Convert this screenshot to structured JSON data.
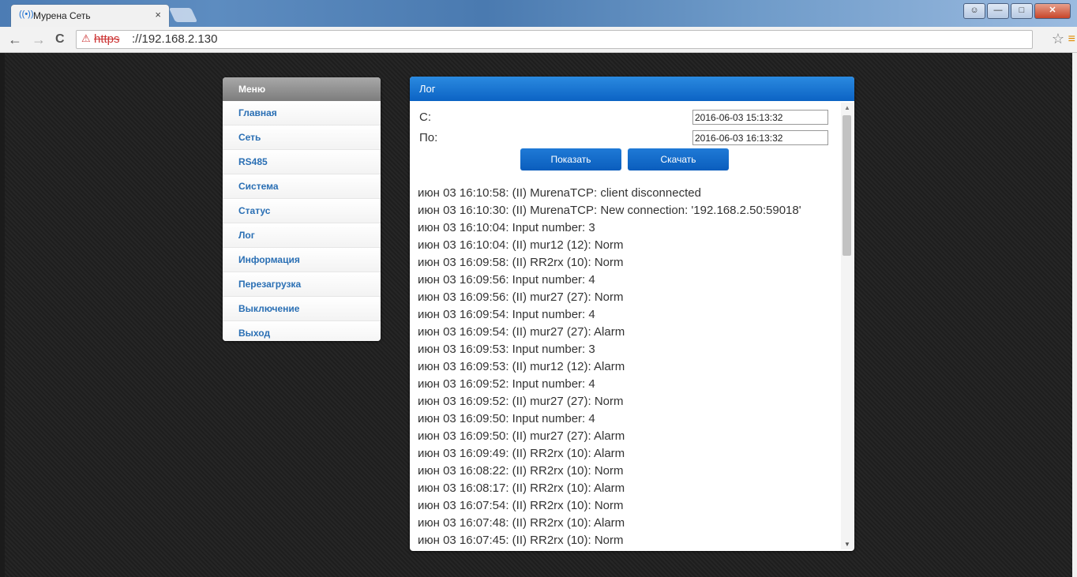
{
  "browser": {
    "tab_title": "Мурена Сеть",
    "tab_close": "×",
    "url_protocol": "https",
    "url_rest": "://192.168.2.130",
    "nav_back": "←",
    "nav_forward": "→",
    "nav_reload": "C",
    "star": "☆",
    "menu": "≡"
  },
  "sidebar": {
    "header": "Меню",
    "items": [
      {
        "label": "Главная"
      },
      {
        "label": "Сеть"
      },
      {
        "label": "RS485"
      },
      {
        "label": "Система"
      },
      {
        "label": "Статус"
      },
      {
        "label": "Лог"
      },
      {
        "label": "Информация"
      },
      {
        "label": "Перезагрузка"
      },
      {
        "label": "Выключение"
      },
      {
        "label": "Выход"
      }
    ]
  },
  "log_panel": {
    "title": "Лог",
    "from_label": "С:",
    "to_label": "По:",
    "from_value": "2016-06-03 15:13:32",
    "to_value": "2016-06-03 16:13:32",
    "show_button": "Показать",
    "download_button": "Скачать",
    "lines": [
      "июн 03 16:10:58: (II) MurenaTCP: client disconnected",
      "июн 03 16:10:30: (II) MurenaTCP: New connection: '192.168.2.50:59018'",
      "июн 03 16:10:04: Input number: 3",
      "июн 03 16:10:04: (II) mur12 (12): Norm",
      "июн 03 16:09:58: (II) RR2rx (10): Norm",
      "июн 03 16:09:56: Input number: 4",
      "июн 03 16:09:56: (II) mur27 (27): Norm",
      "июн 03 16:09:54: Input number: 4",
      "июн 03 16:09:54: (II) mur27 (27): Alarm",
      "июн 03 16:09:53: Input number: 3",
      "июн 03 16:09:53: (II) mur12 (12): Alarm",
      "июн 03 16:09:52: Input number: 4",
      "июн 03 16:09:52: (II) mur27 (27): Norm",
      "июн 03 16:09:50: Input number: 4",
      "июн 03 16:09:50: (II) mur27 (27): Alarm",
      "июн 03 16:09:49: (II) RR2rx (10): Alarm",
      "июн 03 16:08:22: (II) RR2rx (10): Norm",
      "июн 03 16:08:17: (II) RR2rx (10): Alarm",
      "июн 03 16:07:54: (II) RR2rx (10): Norm",
      "июн 03 16:07:48: (II) RR2rx (10): Alarm",
      "июн 03 16:07:45: (II) RR2rx (10): Norm"
    ]
  }
}
